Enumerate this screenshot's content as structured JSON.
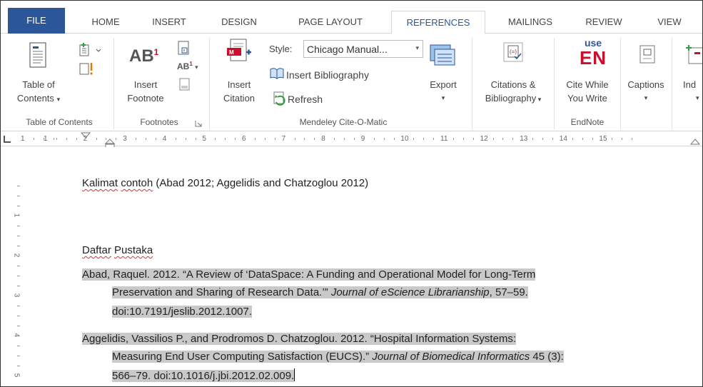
{
  "tabs": [
    {
      "label": "FILE"
    },
    {
      "label": "HOME"
    },
    {
      "label": "INSERT"
    },
    {
      "label": "DESIGN"
    },
    {
      "label": "PAGE LAYOUT"
    },
    {
      "label": "REFERENCES"
    },
    {
      "label": "MAILINGS"
    },
    {
      "label": "REVIEW"
    },
    {
      "label": "VIEW"
    }
  ],
  "active_tab": "REFERENCES",
  "ribbon": {
    "toc": {
      "line1": "Table of",
      "line2": "Contents",
      "group": "Table of Contents"
    },
    "footnotes": {
      "ab_text": "AB",
      "ab_sup": "1",
      "small_ab": "AB",
      "small_sup": "1",
      "line1": "Insert",
      "line2": "Footnote",
      "group": "Footnotes"
    },
    "mendeley": {
      "insert_line1": "Insert",
      "insert_line2": "Citation",
      "style_label": "Style:",
      "style_value": "Chicago Manual...",
      "insert_bibliography": "Insert Bibliography",
      "refresh": "Refresh",
      "export": "Export",
      "group": "Mendeley Cite-O-Matic"
    },
    "citations": {
      "line1": "Citations &",
      "line2": "Bibliography"
    },
    "endnote": {
      "logo_top": "use",
      "logo_main": "EN",
      "line1": "Cite While",
      "line2": "You Write",
      "group": "EndNote"
    },
    "captions": {
      "label": "Captions"
    },
    "index": {
      "label": "Ind"
    }
  },
  "ruler": {
    "labels": [
      "1",
      "1",
      "2",
      "3",
      "4",
      "5",
      "6",
      "7",
      "8",
      "9",
      "10",
      "11",
      "12",
      "13",
      "14",
      "15"
    ]
  },
  "vruler": {
    "labels": [
      "1",
      "2",
      "3",
      "4",
      "5"
    ]
  },
  "document": {
    "line1_a": "Kalimat",
    "line1_b": "contoh",
    "line1_c": "(Abad 2012; Aggelidis and Chatzoglou 2012)",
    "heading_a": "Daftar",
    "heading_b": "Pustaka",
    "ref1": {
      "l1": "Abad, Raquel. 2012. “A Review of ‘DataSpace: A Funding and Operational Model for Long-Term",
      "l2a": "Preservation and Sharing of Research Data.’” ",
      "l2b": "Journal of eScience Librarianship",
      "l2c": ", 57–59.",
      "l3": "doi:10.7191/jeslib.2012.1007."
    },
    "ref2": {
      "l1": "Aggelidis, Vassilios P., and Prodromos D. Chatzoglou. 2012. “Hospital Information Systems:",
      "l2a": "Measuring End User Computing Satisfaction (EUCS).” ",
      "l2b": "Journal of Biomedical Informatics",
      "l2c": " 45 (3):",
      "l3": "566–79. doi:10.1016/j.jbi.2012.02.009."
    }
  },
  "colors": {
    "file_tab": "#2b579a",
    "accent": "#2b579a",
    "highlight": "#c9c9c9",
    "endnote_red": "#c8102e",
    "spellcheck": "#e0302d"
  }
}
